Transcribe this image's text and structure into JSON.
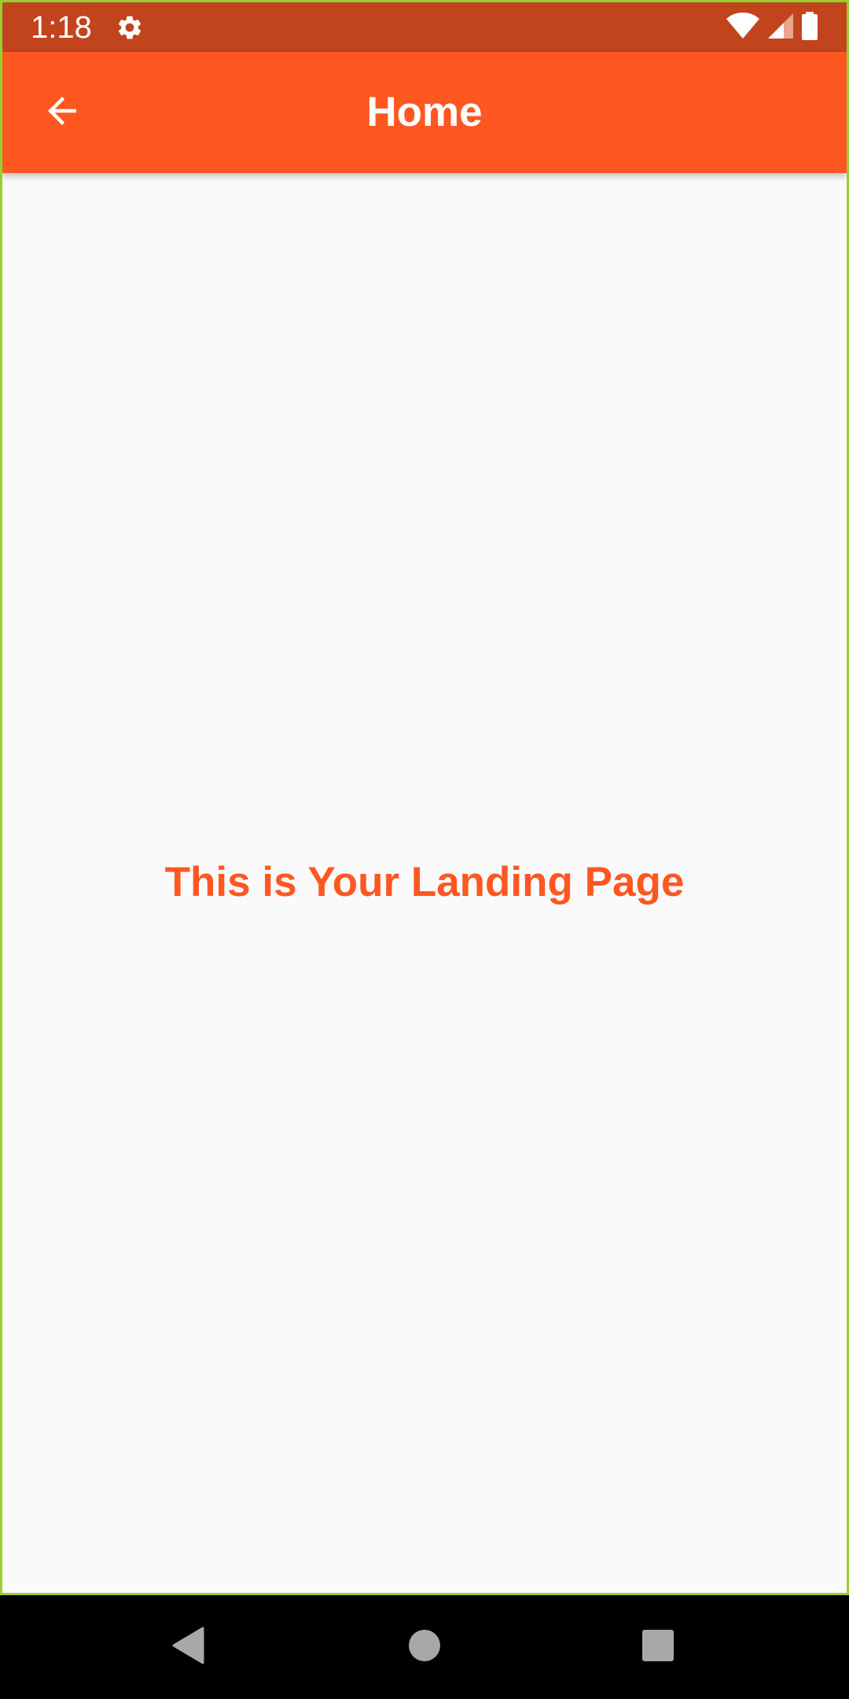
{
  "status_bar": {
    "time": "1:18",
    "icons": [
      "settings-gear-icon",
      "wifi-icon",
      "cellular-signal-icon",
      "battery-icon"
    ],
    "background_color": "#C1441D"
  },
  "app_bar": {
    "title": "Home",
    "back_icon": "arrow-back-icon",
    "background_color": "#FF5722"
  },
  "main": {
    "landing_text": "This is Your Landing Page",
    "text_color": "#FF5722",
    "background_color": "#FAFAFA"
  },
  "nav_bar": {
    "buttons": [
      "back-triangle-icon",
      "home-circle-icon",
      "recents-square-icon"
    ]
  }
}
